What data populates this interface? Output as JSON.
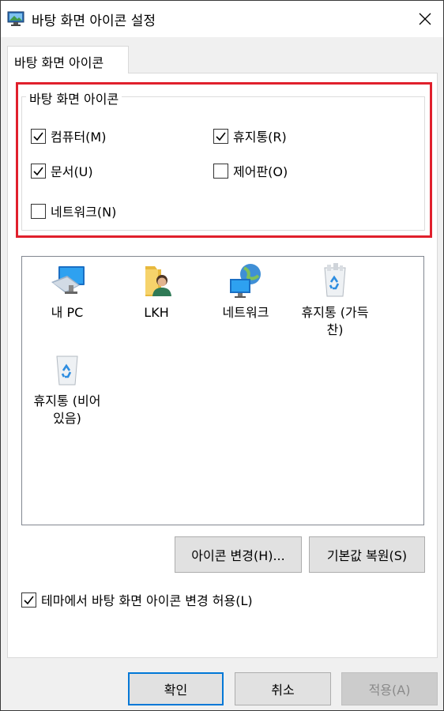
{
  "window": {
    "title": "바탕 화면 아이콘 설정",
    "icon": "desktop-settings-icon",
    "close_icon": "close-icon"
  },
  "tabs": [
    {
      "label": "바탕 화면 아이콘",
      "active": true
    }
  ],
  "group": {
    "legend": "바탕 화면 아이콘",
    "checkboxes": {
      "computer": {
        "label": "컴퓨터(M)",
        "checked": true
      },
      "recycle": {
        "label": "휴지통(R)",
        "checked": true
      },
      "documents": {
        "label": "문서(U)",
        "checked": true
      },
      "control": {
        "label": "제어판(O)",
        "checked": false
      },
      "network": {
        "label": "네트워크(N)",
        "checked": false
      }
    }
  },
  "highlight_color": "#e0202c",
  "icons": {
    "pc": {
      "caption": "내 PC",
      "icon": "computer-icon"
    },
    "user": {
      "caption": "LKH",
      "icon": "user-folder-icon"
    },
    "network": {
      "caption": "네트워크",
      "icon": "network-icon"
    },
    "recycle_full": {
      "caption": "휴지통 (가득 찬)",
      "icon": "recycle-bin-full-icon"
    },
    "recycle_empty": {
      "caption": "휴지통 (비어 있음)",
      "icon": "recycle-bin-empty-icon"
    }
  },
  "actions": {
    "change_icon": "아이콘 변경(H)...",
    "restore_default": "기본값 복원(S)"
  },
  "theme_checkbox": {
    "label": "테마에서 바탕 화면 아이콘 변경 허용(L)",
    "checked": true
  },
  "footer": {
    "ok": "확인",
    "cancel": "취소",
    "apply": "적용(A)",
    "apply_enabled": false
  },
  "accent_color": "#0078d7"
}
